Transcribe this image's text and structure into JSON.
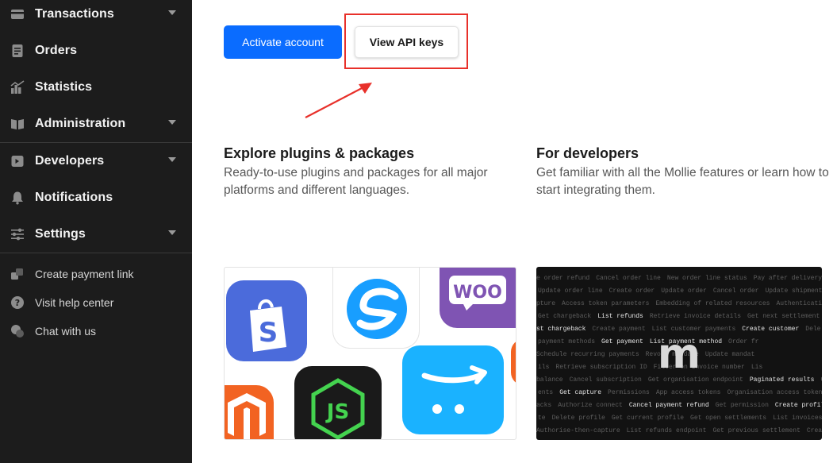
{
  "sidebar": {
    "nav": [
      {
        "label": "Transactions",
        "icon": "transactions-icon",
        "has_dropdown": true
      },
      {
        "label": "Orders",
        "icon": "orders-icon",
        "has_dropdown": false
      },
      {
        "label": "Statistics",
        "icon": "statistics-icon",
        "has_dropdown": false
      },
      {
        "label": "Administration",
        "icon": "administration-icon",
        "has_dropdown": true
      },
      {
        "label": "Developers",
        "icon": "developers-icon",
        "has_dropdown": true
      },
      {
        "label": "Notifications",
        "icon": "bell-icon",
        "has_dropdown": false
      },
      {
        "label": "Settings",
        "icon": "sliders-icon",
        "has_dropdown": true
      }
    ],
    "links": [
      {
        "label": "Create payment link",
        "icon": "link-icon"
      },
      {
        "label": "Visit help center",
        "icon": "help-icon"
      },
      {
        "label": "Chat with us",
        "icon": "chat-icon"
      }
    ]
  },
  "actions": {
    "activate_label": "Activate account",
    "api_keys_label": "View API keys"
  },
  "sections": {
    "plugins": {
      "title": "Explore plugins & packages",
      "description": "Ready-to-use plugins and packages for all major platforms and different languages."
    },
    "developers": {
      "title": "For developers",
      "description": "Get familiar with all the Mollie features or learn how to start integrating them."
    }
  },
  "plugin_tiles": {
    "woo_label": "WOO",
    "js_label": "JS",
    "shopify_label": "S"
  },
  "dev_card": {
    "logo_text": "m",
    "code_lines": [
      [
        [
          "e order refund",
          0
        ],
        [
          "Cancel order line",
          0
        ],
        [
          "New order line status",
          0
        ],
        [
          "Pay after delivery a",
          0
        ]
      ],
      [
        [
          "Update order line",
          0
        ],
        [
          "Create order",
          0
        ],
        [
          "Update order",
          0
        ],
        [
          "Cancel order",
          0
        ],
        [
          "Update shipment",
          0
        ]
      ],
      [
        [
          "pture",
          0
        ],
        [
          "Access token parameters",
          0
        ],
        [
          "Embedding of related resources",
          0
        ],
        [
          "Authenticati",
          0
        ]
      ],
      [
        [
          "Get chargeback",
          0
        ],
        [
          "List refunds",
          1
        ],
        [
          "Retrieve invoice details",
          0
        ],
        [
          "Get next settlement",
          0
        ],
        [
          "Ca",
          0
        ]
      ],
      [
        [
          "st chargeback",
          1
        ],
        [
          "Create payment",
          0
        ],
        [
          "List customer payments",
          0
        ],
        [
          "Create customer",
          1
        ],
        [
          "Dele",
          0
        ]
      ],
      [
        [
          "payment methods",
          0
        ],
        [
          "Get payment",
          1
        ],
        [
          "List payment method",
          1
        ],
        [
          "Order fr",
          0
        ]
      ],
      [
        [
          "Schedule recurring payments",
          0
        ],
        [
          "Revoke mandate",
          0
        ],
        [
          "Update mandat",
          0
        ]
      ],
      [
        [
          "ils",
          0
        ],
        [
          "Retrieve subscription ID",
          0
        ],
        [
          "Filter on invoice number",
          0
        ],
        [
          "Lis",
          0
        ]
      ],
      [
        [
          "balance",
          0
        ],
        [
          "Cancel subscription",
          0
        ],
        [
          "Get organisation endpoint",
          0
        ],
        [
          "Paginated results",
          1
        ],
        [
          "Ge",
          0
        ]
      ],
      [
        [
          "ents",
          0
        ],
        [
          "Get capture",
          1
        ],
        [
          "Permissions",
          0
        ],
        [
          "App access tokens",
          0
        ],
        [
          "Organisation access tokens",
          0
        ]
      ],
      [
        [
          "acks",
          0
        ],
        [
          "Authorize connect",
          0
        ],
        [
          "Cancel payment refund",
          1
        ],
        [
          "Get permission",
          0
        ],
        [
          "Create profile",
          1
        ]
      ],
      [
        [
          "te",
          0
        ],
        [
          "Delete profile",
          0
        ],
        [
          "Get current profile",
          0
        ],
        [
          "Get open settlements",
          0
        ],
        [
          "List invoices",
          0
        ]
      ],
      [
        [
          "Authorise-then-capture",
          0
        ],
        [
          "List refunds endpoint",
          0
        ],
        [
          "Get previous settlement",
          0
        ],
        [
          "Creat",
          0
        ]
      ]
    ]
  },
  "colors": {
    "sidebar_bg": "#1c1c1c",
    "primary_blue": "#0a6cff",
    "highlight_red": "#e8302a",
    "shopify_bg": "#4b6bdb",
    "shopware_blue": "#189eff",
    "woo_purple": "#7f54b3",
    "magento_orange": "#f26322",
    "node_green": "#44d34f",
    "prestashop_blue": "#1ab2ff"
  }
}
